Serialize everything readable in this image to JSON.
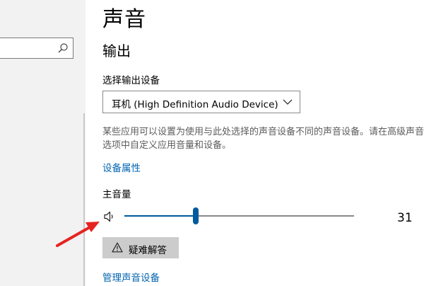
{
  "page": {
    "title": "声音"
  },
  "output": {
    "section_title": "输出",
    "device_label": "选择输出设备",
    "device_selected": "耳机 (High Definition Audio Device)",
    "description": "某些应用可以设置为使用与此处选择的声音设备不同的声音设备。请在高级声音选项中自定义应用音量和设备。",
    "device_properties_link": "设备属性",
    "master_volume_label": "主音量",
    "volume_value": "31",
    "volume_percent": 31,
    "troubleshoot_label": "疑难解答",
    "manage_devices_link": "管理声音设备"
  },
  "icons": {
    "search": "search-icon",
    "dropdown": "chevron-down-icon",
    "speaker": "speaker-icon",
    "warning": "warning-icon",
    "annotation": "red-arrow"
  },
  "colors": {
    "accent": "#005a9e",
    "link": "#0063b1",
    "annotation": "#e52421",
    "button_bg": "#cccccc"
  }
}
